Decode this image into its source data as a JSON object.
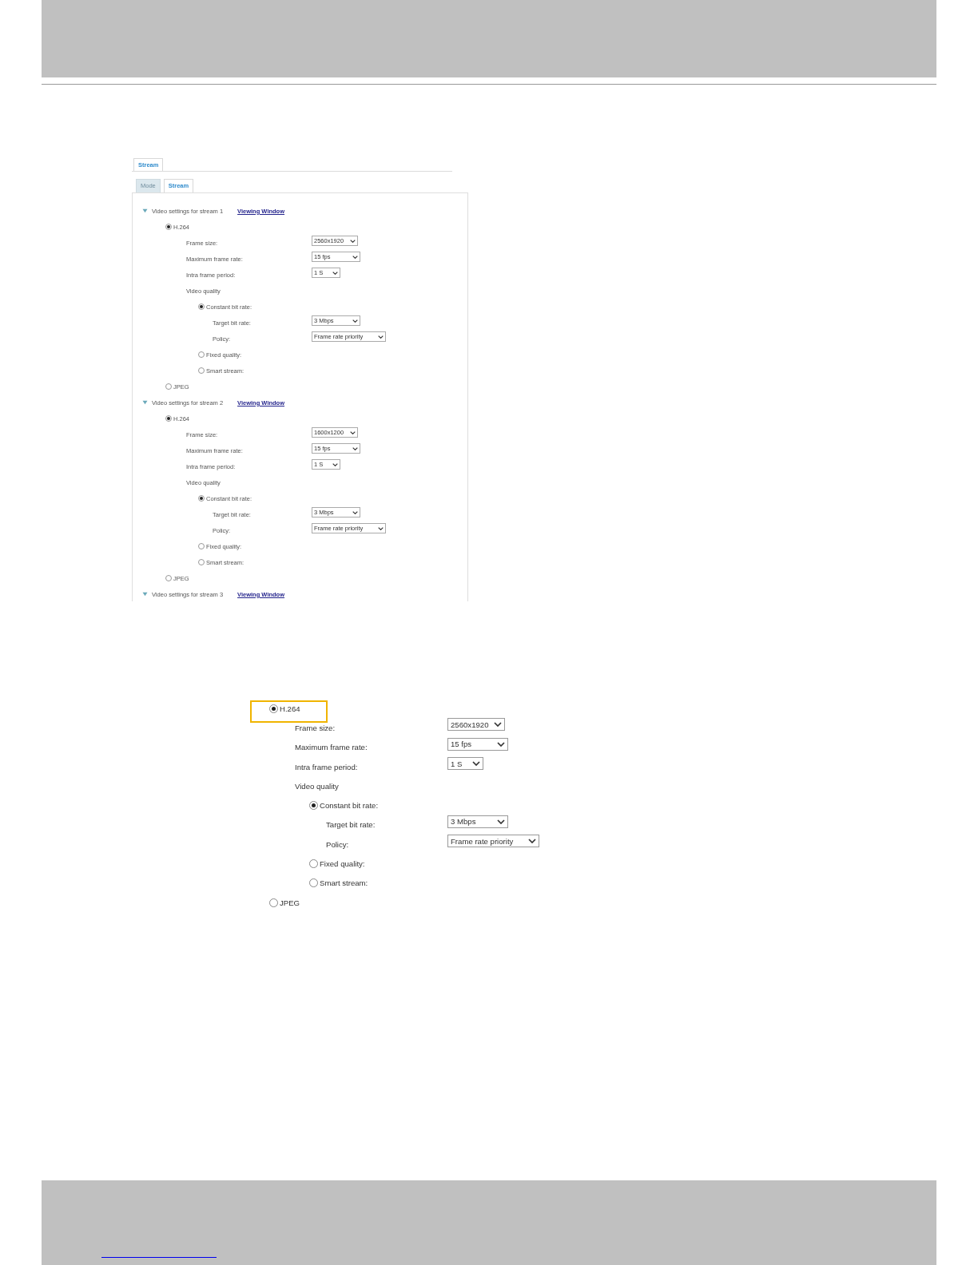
{
  "screenshot": {
    "outer_tabs": [
      {
        "label": "Stream",
        "selected": true
      }
    ],
    "tabs": [
      {
        "label": "Mode",
        "selected": false
      },
      {
        "label": "Stream",
        "selected": true
      }
    ],
    "sections": [
      {
        "title": "Video settings for stream 1",
        "expanded": true,
        "link": "Viewing Window",
        "codecs": [
          {
            "label": "H.264",
            "selected": true,
            "fields": [
              {
                "label": "Frame size:",
                "value": "2560x1920"
              },
              {
                "label": "Maximum frame rate:",
                "value": "15 fps"
              },
              {
                "label": "Intra frame period:",
                "value": "1 S"
              }
            ],
            "quality_label": "Video quality",
            "quality_options": [
              {
                "label": "Constant bit rate:",
                "selected": true,
                "fields": [
                  {
                    "label": "Target bit rate:",
                    "value": "3 Mbps"
                  },
                  {
                    "label": "Policy:",
                    "value": "Frame rate priority"
                  }
                ]
              },
              {
                "label": "Fixed quality:",
                "selected": false
              },
              {
                "label": "Smart stream:",
                "selected": false
              }
            ]
          },
          {
            "label": "JPEG",
            "selected": false
          }
        ]
      },
      {
        "title": "Video settings for stream 2",
        "expanded": true,
        "link": "Viewing Window",
        "codecs": [
          {
            "label": "H.264",
            "selected": true,
            "fields": [
              {
                "label": "Frame size:",
                "value": "1600x1200"
              },
              {
                "label": "Maximum frame rate:",
                "value": "15 fps"
              },
              {
                "label": "Intra frame period:",
                "value": "1 S"
              }
            ],
            "quality_label": "Video quality",
            "quality_options": [
              {
                "label": "Constant bit rate:",
                "selected": true,
                "fields": [
                  {
                    "label": "Target bit rate:",
                    "value": "3 Mbps"
                  },
                  {
                    "label": "Policy:",
                    "value": "Frame rate priority"
                  }
                ]
              },
              {
                "label": "Fixed quality:",
                "selected": false
              },
              {
                "label": "Smart stream:",
                "selected": false
              }
            ]
          },
          {
            "label": "JPEG",
            "selected": false
          }
        ]
      },
      {
        "title": "Video settings for stream 3",
        "expanded": true,
        "link": "Viewing Window"
      }
    ]
  },
  "detail": {
    "codecs": [
      {
        "label": "H.264",
        "selected": true,
        "highlighted": true,
        "fields": [
          {
            "label": "Frame size:",
            "value": "2560x1920"
          },
          {
            "label": "Maximum frame rate:",
            "value": "15 fps"
          },
          {
            "label": "Intra frame period:",
            "value": "1 S"
          }
        ],
        "quality_label": "Video quality",
        "quality_options": [
          {
            "label": "Constant bit rate:",
            "selected": true,
            "fields": [
              {
                "label": "Target bit rate:",
                "value": "3 Mbps"
              },
              {
                "label": "Policy:",
                "value": "Frame rate priority"
              }
            ]
          },
          {
            "label": "Fixed quality:",
            "selected": false
          },
          {
            "label": "Smart stream:",
            "selected": false
          }
        ]
      },
      {
        "label": "JPEG",
        "selected": false,
        "highlighted": false
      }
    ]
  }
}
